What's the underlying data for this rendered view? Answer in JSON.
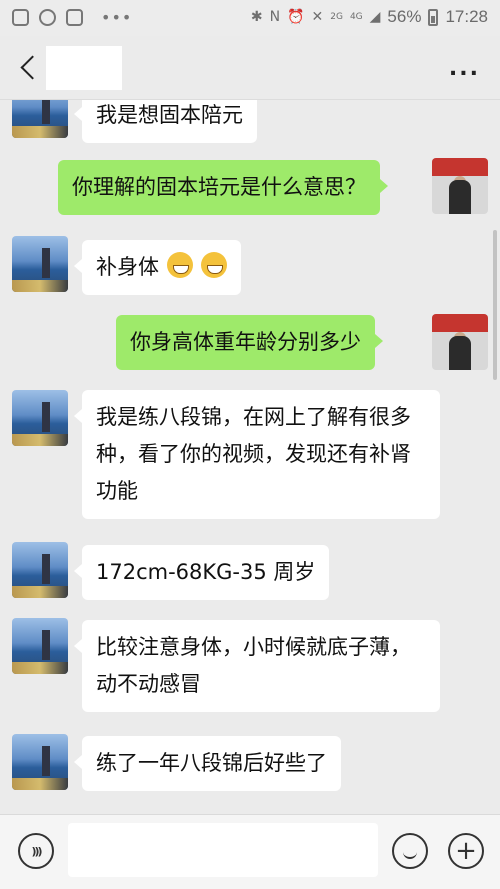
{
  "status_bar": {
    "signal_2g": "2G",
    "signal_4g": "4G",
    "battery_text": "56%",
    "time": "17:28"
  },
  "header": {
    "title": "",
    "more_label": "..."
  },
  "messages": [
    {
      "side": "in",
      "text": "我是想固本陪元"
    },
    {
      "side": "out",
      "text": "你理解的固本培元是什么意思？"
    },
    {
      "side": "in",
      "text": "补身体"
    },
    {
      "side": "out",
      "text": "你身高体重年龄分别多少"
    },
    {
      "side": "in",
      "text": "我是练八段锦，在网上了解有很多种，看了你的视频，发现还有补肾功能"
    },
    {
      "side": "in",
      "text": "172cm-68KG-35 周岁"
    },
    {
      "side": "in",
      "text": "比较注意身体，小时候就底子薄，动不动感冒"
    },
    {
      "side": "in",
      "text": "练了一年八段锦后好些了"
    }
  ],
  "input_bar": {
    "placeholder": "",
    "plus_label": "+"
  }
}
